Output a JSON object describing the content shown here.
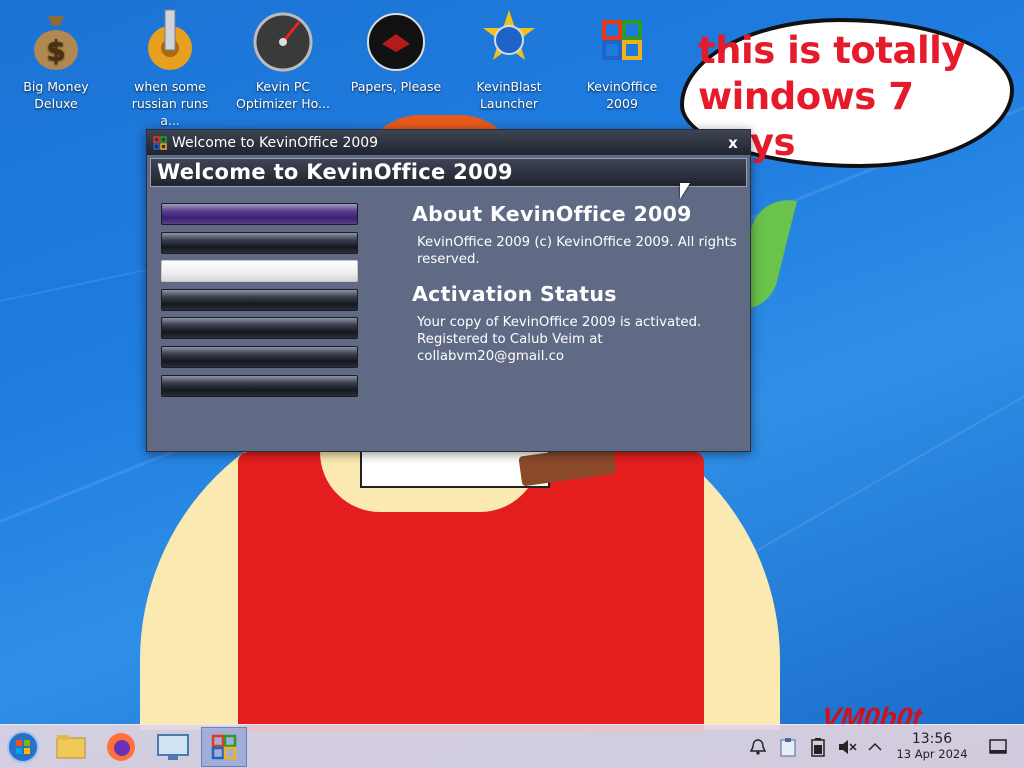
{
  "desktop": {
    "icons": [
      {
        "label": "Big Money Deluxe",
        "icon": "money-bag-icon"
      },
      {
        "label": "when some russian runs a...",
        "icon": "gear-tower-icon"
      },
      {
        "label": "Kevin PC Optimizer Ho...",
        "icon": "speedometer-icon"
      },
      {
        "label": "Papers, Please",
        "icon": "papers-please-icon"
      },
      {
        "label": "KevinBlast Launcher",
        "icon": "kevinblast-globe-icon"
      },
      {
        "label": "KevinOffice 2009",
        "icon": "kevinoffice-logo-icon"
      }
    ],
    "bubble_text": "this is totally windows 7 guys",
    "watermark": "VM0b0t"
  },
  "window": {
    "title": "Welcome to KevinOffice 2009",
    "close_label": "x",
    "header": "Welcome to KevinOffice 2009",
    "nav_buttons": [
      {
        "state": "selected"
      },
      {
        "state": "normal"
      },
      {
        "state": "hover"
      },
      {
        "state": "normal"
      },
      {
        "state": "normal"
      },
      {
        "state": "normal"
      },
      {
        "state": "normal"
      }
    ],
    "about_heading": "About KevinOffice 2009",
    "about_text": "KevinOffice 2009 (c) KevinOffice 2009. All rights reserved.",
    "activation_heading": "Activation Status",
    "activation_text": "Your copy of KevinOffice 2009 is activated.\nRegistered to Calub Veim at collabvm20@gmail.co"
  },
  "taskbar": {
    "buttons": [
      "start-orb-icon",
      "file-explorer-icon",
      "firefox-icon",
      "remote-desktop-icon",
      "kevinoffice-taskbar-icon"
    ],
    "active_button": "kevinoffice-taskbar-icon",
    "tray_icons": [
      "notifications-icon",
      "clipboard-icon",
      "battery-icon",
      "volume-muted-icon",
      "chevron-up-icon"
    ],
    "time": "13:56",
    "date": "13 Apr 2024",
    "show_desktop_icon": "show-desktop-icon"
  },
  "colors": {
    "wallpaper": "#1f7ce0",
    "window_body": "#616a85",
    "bubble_text": "#e51b2c",
    "selected_nav": "#3b1f72"
  }
}
